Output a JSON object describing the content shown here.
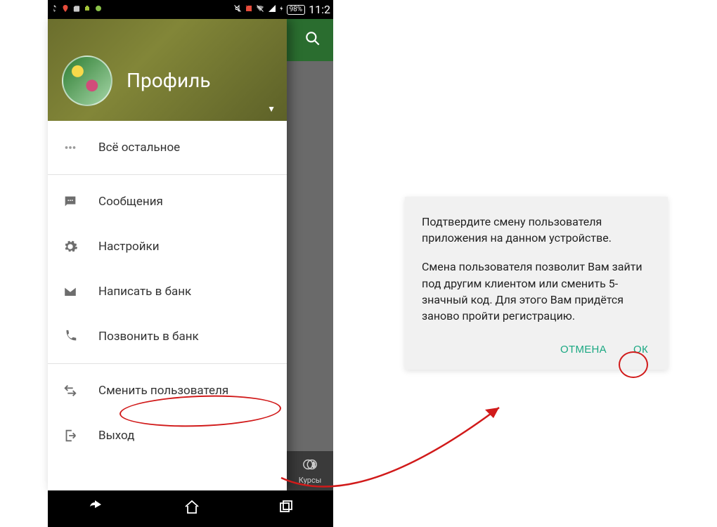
{
  "statusbar": {
    "battery": "98%",
    "time": "11:2"
  },
  "drawer": {
    "title": "Профиль",
    "items": [
      {
        "label": "Всё остальное"
      },
      {
        "label": "Сообщения"
      },
      {
        "label": "Настройки"
      },
      {
        "label": "Написать в банк"
      },
      {
        "label": "Позвонить в банк"
      },
      {
        "label": "Сменить пользователя"
      },
      {
        "label": "Выход"
      }
    ]
  },
  "bottom_tab": {
    "label": "Курсы"
  },
  "dialog": {
    "p1": "Подтвердите смену пользователя приложения на данном устройстве.",
    "p2": "Смена пользователя позволит Вам зайти под другим клиентом или сменить 5-значный код. Для этого Вам придётся заново пройти регистрацию.",
    "cancel": "ОТМЕНА",
    "ok": "ОК"
  }
}
